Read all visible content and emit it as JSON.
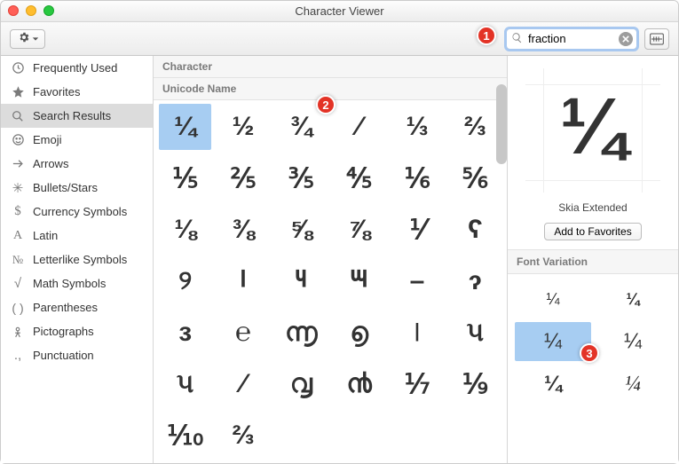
{
  "window": {
    "title": "Character Viewer"
  },
  "toolbar": {
    "search_value": "fraction",
    "search_placeholder": "Search"
  },
  "sidebar": {
    "items": [
      {
        "icon": "clock",
        "label": "Frequently Used"
      },
      {
        "icon": "star",
        "label": "Favorites"
      },
      {
        "icon": "search",
        "label": "Search Results",
        "selected": true
      },
      {
        "icon": "smiley",
        "label": "Emoji"
      },
      {
        "icon": "arrow",
        "label": "Arrows"
      },
      {
        "icon": "bullet",
        "label": "Bullets/Stars"
      },
      {
        "icon": "dollar",
        "label": "Currency Symbols"
      },
      {
        "icon": "letterA",
        "label": "Latin"
      },
      {
        "icon": "numero",
        "label": "Letterlike Symbols"
      },
      {
        "icon": "sqrt",
        "label": "Math Symbols"
      },
      {
        "icon": "parens",
        "label": "Parentheses"
      },
      {
        "icon": "picto",
        "label": "Pictographs"
      },
      {
        "icon": "punct",
        "label": "Punctuation"
      }
    ]
  },
  "grid": {
    "header1": "Character",
    "header2": "Unicode Name",
    "glyphs": [
      "¼",
      "½",
      "¾",
      "⁄",
      "⅓",
      "⅔",
      "⅕",
      "⅖",
      "⅗",
      "⅘",
      "⅙",
      "⅚",
      "⅛",
      "⅜",
      "⅝",
      "⅞",
      "⅟",
      "ʕ",
      "୨",
      "౹",
      "౺",
      "౻",
      "–",
      "ɂ",
      "ɜ",
      "℮",
      "൬",
      "൭",
      "৷",
      "૫",
      "૫",
      "⁄",
      "൮",
      "൯",
      "⅐",
      "⅑",
      "⅒",
      "⅔"
    ],
    "selected_index": 0
  },
  "detail": {
    "preview_glyph": "¼",
    "font_name": "Skia Extended",
    "fav_button": "Add to Favorites",
    "section_label": "Font Variation",
    "variations": [
      "¼",
      "¼",
      "¼",
      "¼",
      "¼",
      "¼"
    ],
    "selected_variation": 2
  },
  "callouts": {
    "c1": "1",
    "c2": "2",
    "c3": "3"
  }
}
